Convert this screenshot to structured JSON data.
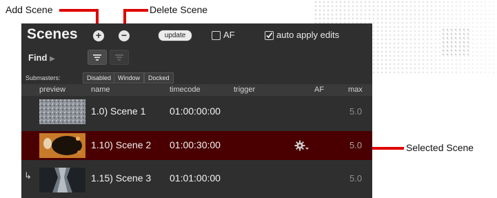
{
  "callouts": {
    "add_scene": "Add Scene",
    "delete_scene": "Delete Scene",
    "selected_scene": "Selected Scene"
  },
  "panel": {
    "title": "Scenes",
    "add_glyph": "+",
    "delete_glyph": "−",
    "update_label": "update",
    "af_label": "AF",
    "af_checked": false,
    "auto_apply_label": "auto apply edits",
    "auto_apply_checked": true,
    "find_label": "Find",
    "find_arrow": "▶",
    "submasters_label": "Submasters:",
    "submaster_options": [
      "Disabled",
      "Window",
      "Docked"
    ]
  },
  "table": {
    "columns": [
      "preview",
      "name",
      "timecode",
      "trigger",
      "AF",
      "max"
    ],
    "rows": [
      {
        "name": "1.0) Scene 1",
        "timecode": "01:00:00:00",
        "trigger": "",
        "max": "5.0",
        "selected": false,
        "child_arrow": ""
      },
      {
        "name": "1.10) Scene 2",
        "timecode": "01:00:30:00",
        "trigger": "gear-dropdown-icon",
        "max": "5.0",
        "selected": true,
        "child_arrow": ""
      },
      {
        "name": "1.15) Scene 3",
        "timecode": "01:01:00:00",
        "trigger": "",
        "max": "5.0",
        "selected": false,
        "child_arrow": "↳"
      }
    ]
  },
  "colors": {
    "panel_bg": "#2f2f2f",
    "selected_row": "#4a0000",
    "callout_red": "#e00000"
  }
}
